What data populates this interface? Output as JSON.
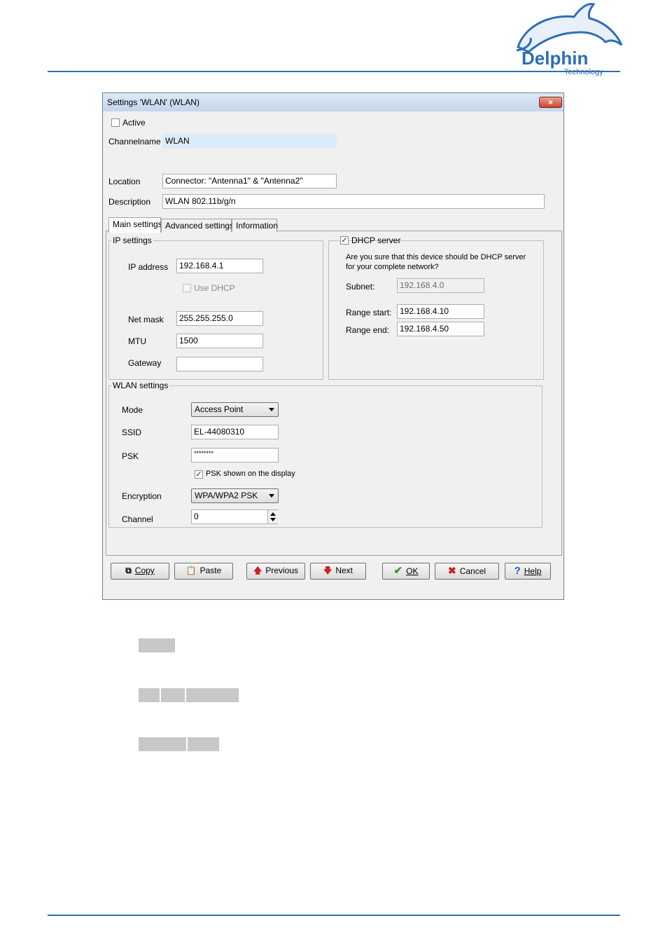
{
  "brand": {
    "name": "Delphin",
    "sub": "Technology"
  },
  "window": {
    "title": "Settings 'WLAN' (WLAN)",
    "close_glyph": "×",
    "active_label": "Active",
    "channelname_label": "Channelname",
    "channelname_value": "WLAN",
    "location_label": "Location",
    "location_value": "Connector: \"Antenna1\" & \"Antenna2\"",
    "description_label": "Description",
    "description_value": "WLAN 802.11b/g/n"
  },
  "tabs": [
    "Main settings",
    "Advanced settings",
    "Information"
  ],
  "ip_settings": {
    "legend": "IP settings",
    "ip_label": "IP address",
    "ip_value": "192.168.4.1",
    "use_dhcp_label": "Use DHCP",
    "netmask_label": "Net mask",
    "netmask_value": "255.255.255.0",
    "mtu_label": "MTU",
    "mtu_value": "1500",
    "gateway_label": "Gateway",
    "gateway_value": ""
  },
  "dhcp": {
    "legend": "DHCP server",
    "checked": true,
    "warning_line1": "Are you sure that this device should be DHCP server",
    "warning_line2": "for your complete network?",
    "subnet_label": "Subnet:",
    "subnet_value": "192.168.4.0",
    "range_start_label": "Range start:",
    "range_start_value": "192.168.4.10",
    "range_end_label": "Range end:",
    "range_end_value": "192.168.4.50"
  },
  "wlan": {
    "legend": "WLAN settings",
    "mode_label": "Mode",
    "mode_value": "Access Point",
    "ssid_label": "SSID",
    "ssid_value": "EL-44080310",
    "psk_label": "PSK",
    "psk_value": "********",
    "psk_shown_label": "PSK shown on the display",
    "psk_shown_checked": true,
    "encryption_label": "Encryption",
    "encryption_value": "WPA/WPA2 PSK",
    "channel_label": "Channel",
    "channel_value": "0"
  },
  "buttons": {
    "copy": "Copy",
    "paste": "Paste",
    "previous": "Previous",
    "next": "Next",
    "ok": "OK",
    "cancel": "Cancel",
    "help": "Help"
  },
  "icons": {
    "copy": "copy-icon",
    "paste": "paste-icon",
    "previous": "arrow-up-icon",
    "next": "arrow-down-icon",
    "ok": "checkmark-icon",
    "cancel": "x-icon",
    "help": "question-icon"
  },
  "colors": {
    "rule": "#2f6db5",
    "ok_green": "#2a9a2a",
    "cancel_red": "#c82020",
    "prev_red": "#d02020",
    "help_blue": "#1f5fc0"
  }
}
